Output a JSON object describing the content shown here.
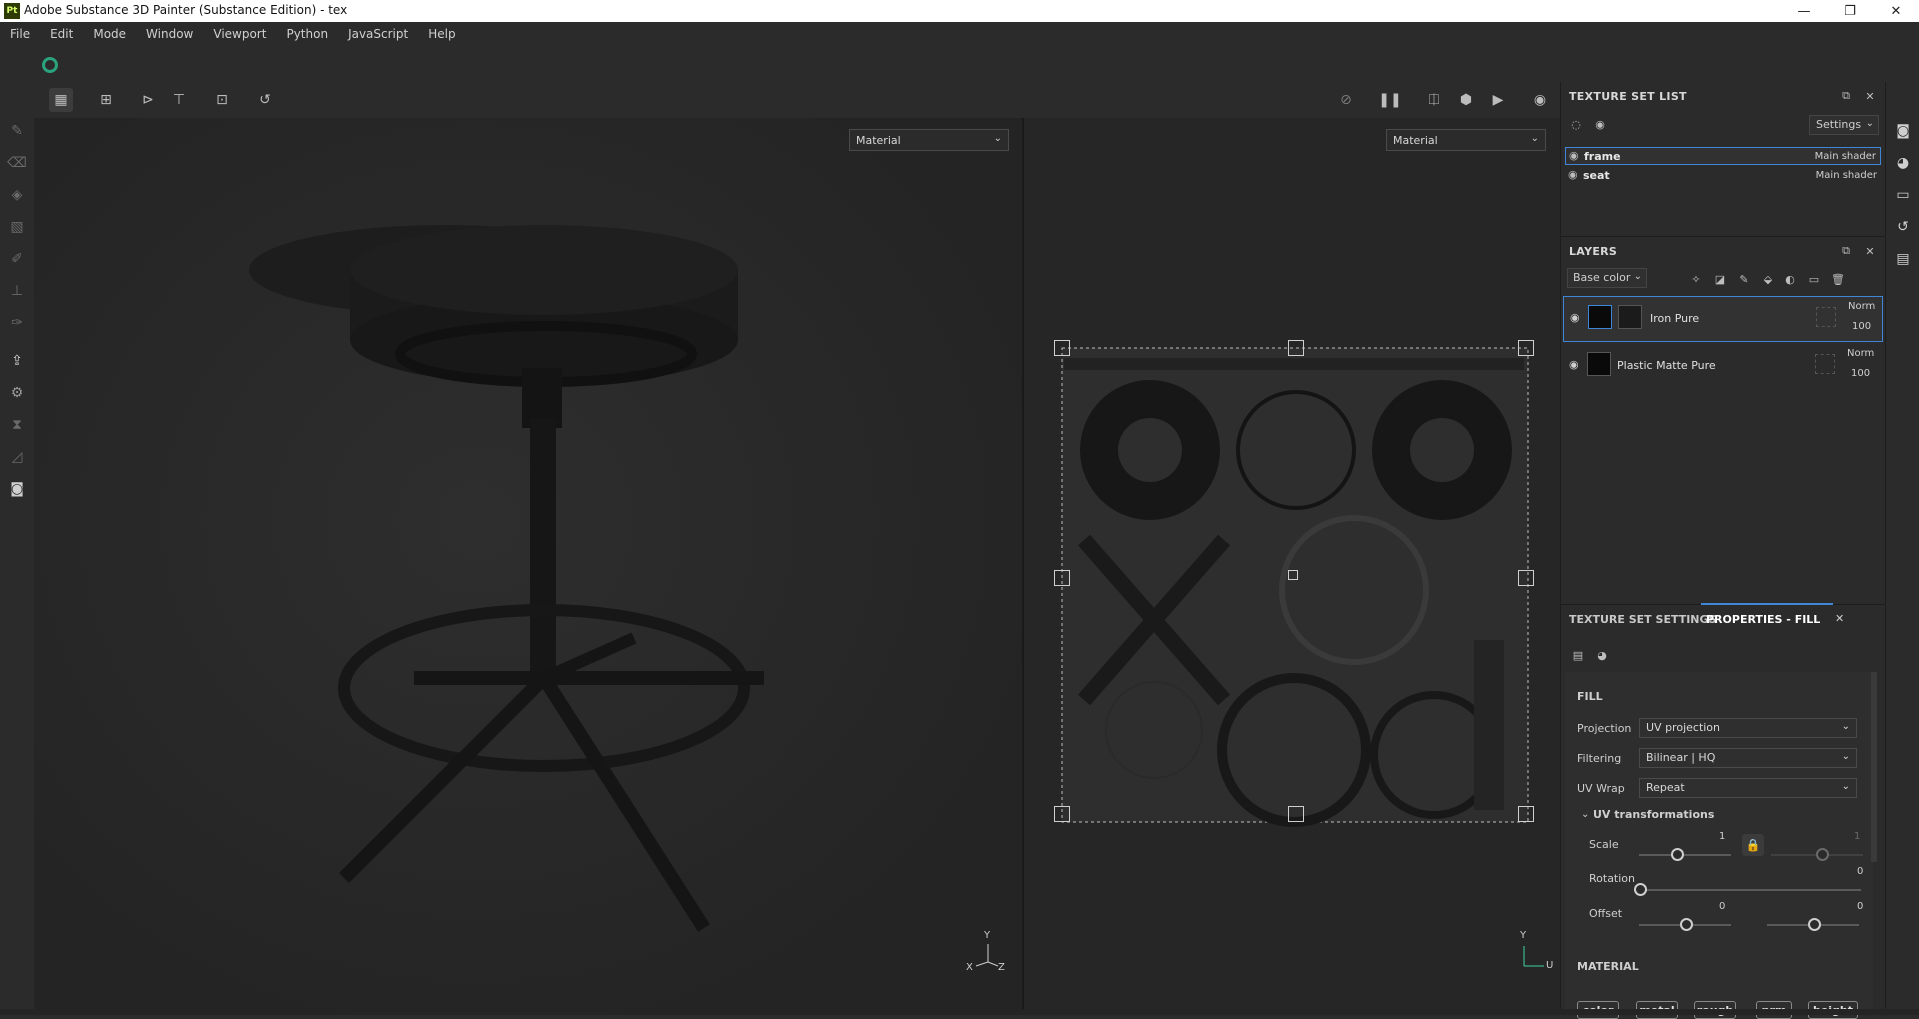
{
  "titlebar": {
    "badge": "Pt",
    "title": "Adobe Substance 3D Painter (Substance Edition) - tex",
    "minimize": "—",
    "restore": "❐",
    "close": "✕"
  },
  "menu": [
    "File",
    "Edit",
    "Mode",
    "Window",
    "Viewport",
    "Python",
    "JavaScript",
    "Help"
  ],
  "viewport_3d": {
    "select_value": "Material"
  },
  "viewport_2d": {
    "select_value": "Material"
  },
  "axes": {
    "y": "Y",
    "x": "X",
    "z": "Z",
    "u": "U"
  },
  "texture_set_list": {
    "title": "TEXTURE SET LIST",
    "settings_label": "Settings",
    "items": [
      {
        "name": "frame",
        "shader": "Main shader",
        "selected": true
      },
      {
        "name": "seat",
        "shader": "Main shader",
        "selected": false
      }
    ]
  },
  "layers": {
    "title": "LAYERS",
    "channel": "Base color",
    "items": [
      {
        "name": "Iron Pure",
        "blend": "Norm",
        "opacity": "100",
        "selected": true
      },
      {
        "name": "Plastic Matte Pure",
        "blend": "Norm",
        "opacity": "100",
        "selected": false
      }
    ]
  },
  "properties": {
    "tab_ts_settings": "TEXTURE SET SETTINGS",
    "tab_fill": "PROPERTIES - FILL",
    "fill_heading": "FILL",
    "projection": {
      "label": "Projection",
      "value": "UV projection"
    },
    "filtering": {
      "label": "Filtering",
      "value": "Bilinear | HQ"
    },
    "uvwrap": {
      "label": "UV Wrap",
      "value": "Repeat"
    },
    "uv_transformations": "UV transformations",
    "scale": {
      "label": "Scale",
      "value1": "1",
      "value2": "1",
      "level": 0.4
    },
    "rotation": {
      "label": "Rotation",
      "value": "0",
      "level": 0.0
    },
    "offset": {
      "label": "Offset",
      "value1": "0",
      "value2": "0",
      "level": 0.5
    },
    "material_heading": "MATERIAL",
    "material_channels": [
      "color",
      "metal",
      "rough",
      "nrm",
      "height"
    ]
  },
  "colors": {
    "accent": "#2aa37e",
    "selection_border": "#3f86d6",
    "tab_active": "#3f86d6"
  }
}
